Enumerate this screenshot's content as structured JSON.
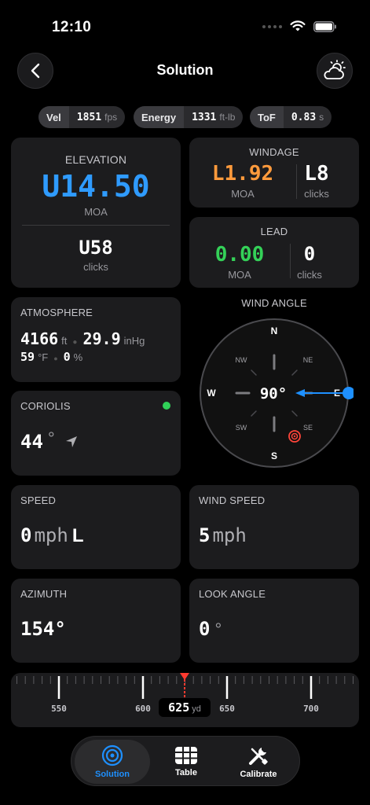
{
  "status": {
    "time": "12:10"
  },
  "nav": {
    "title": "Solution",
    "back_icon": "chevron-left-icon",
    "weather_icon": "cloud-sun-icon"
  },
  "pills": [
    {
      "label": "Vel",
      "value": "1851",
      "unit": "fps"
    },
    {
      "label": "Energy",
      "value": "1331",
      "unit": "ft-lb"
    },
    {
      "label": "ToF",
      "value": "0.83",
      "unit": "s"
    }
  ],
  "elevation": {
    "label": "ELEVATION",
    "value": "U14.50",
    "unit": "MOA",
    "clicks": "U58",
    "clicks_label": "clicks",
    "color": "#2f9bff"
  },
  "windage": {
    "label": "WINDAGE",
    "value": "L1.92",
    "unit": "MOA",
    "clicks": "L8",
    "clicks_label": "clicks",
    "color": "#ff9a3c"
  },
  "lead": {
    "label": "LEAD",
    "value": "0.00",
    "unit": "MOA",
    "clicks": "0",
    "clicks_label": "clicks",
    "color": "#34d158"
  },
  "atmosphere": {
    "label": "ATMOSPHERE",
    "altitude": "4166",
    "altitude_unit": "ft",
    "pressure": "29.9",
    "pressure_unit": "inHg",
    "temp": "59",
    "temp_unit": "°F",
    "humidity": "0",
    "humidity_unit": "%"
  },
  "wind_angle": {
    "label": "WIND ANGLE",
    "value": "90°",
    "n": "N",
    "s": "S",
    "e": "E",
    "w": "W",
    "nw": "NW",
    "ne": "NE",
    "sw": "SW",
    "se": "SE",
    "angle_deg": 90
  },
  "coriolis": {
    "label": "CORIOLIS",
    "value": "44",
    "unit": "°",
    "status_color": "#30d158"
  },
  "speed": {
    "label": "SPEED",
    "value": "0",
    "unit": "mph",
    "dir": "L"
  },
  "wind_speed": {
    "label": "WIND SPEED",
    "value": "5",
    "unit": "mph"
  },
  "azimuth": {
    "label": "AZIMUTH",
    "value": "154°"
  },
  "look_angle": {
    "label": "LOOK ANGLE",
    "value": "0",
    "unit": "°"
  },
  "range": {
    "value": "625",
    "unit": "yd",
    "ticks": [
      "550",
      "600",
      "650",
      "700"
    ]
  },
  "tabs": [
    {
      "label": "Solution",
      "icon": "target-icon"
    },
    {
      "label": "Table",
      "icon": "table-icon"
    },
    {
      "label": "Calibrate",
      "icon": "wrench-screwdriver-icon"
    }
  ]
}
